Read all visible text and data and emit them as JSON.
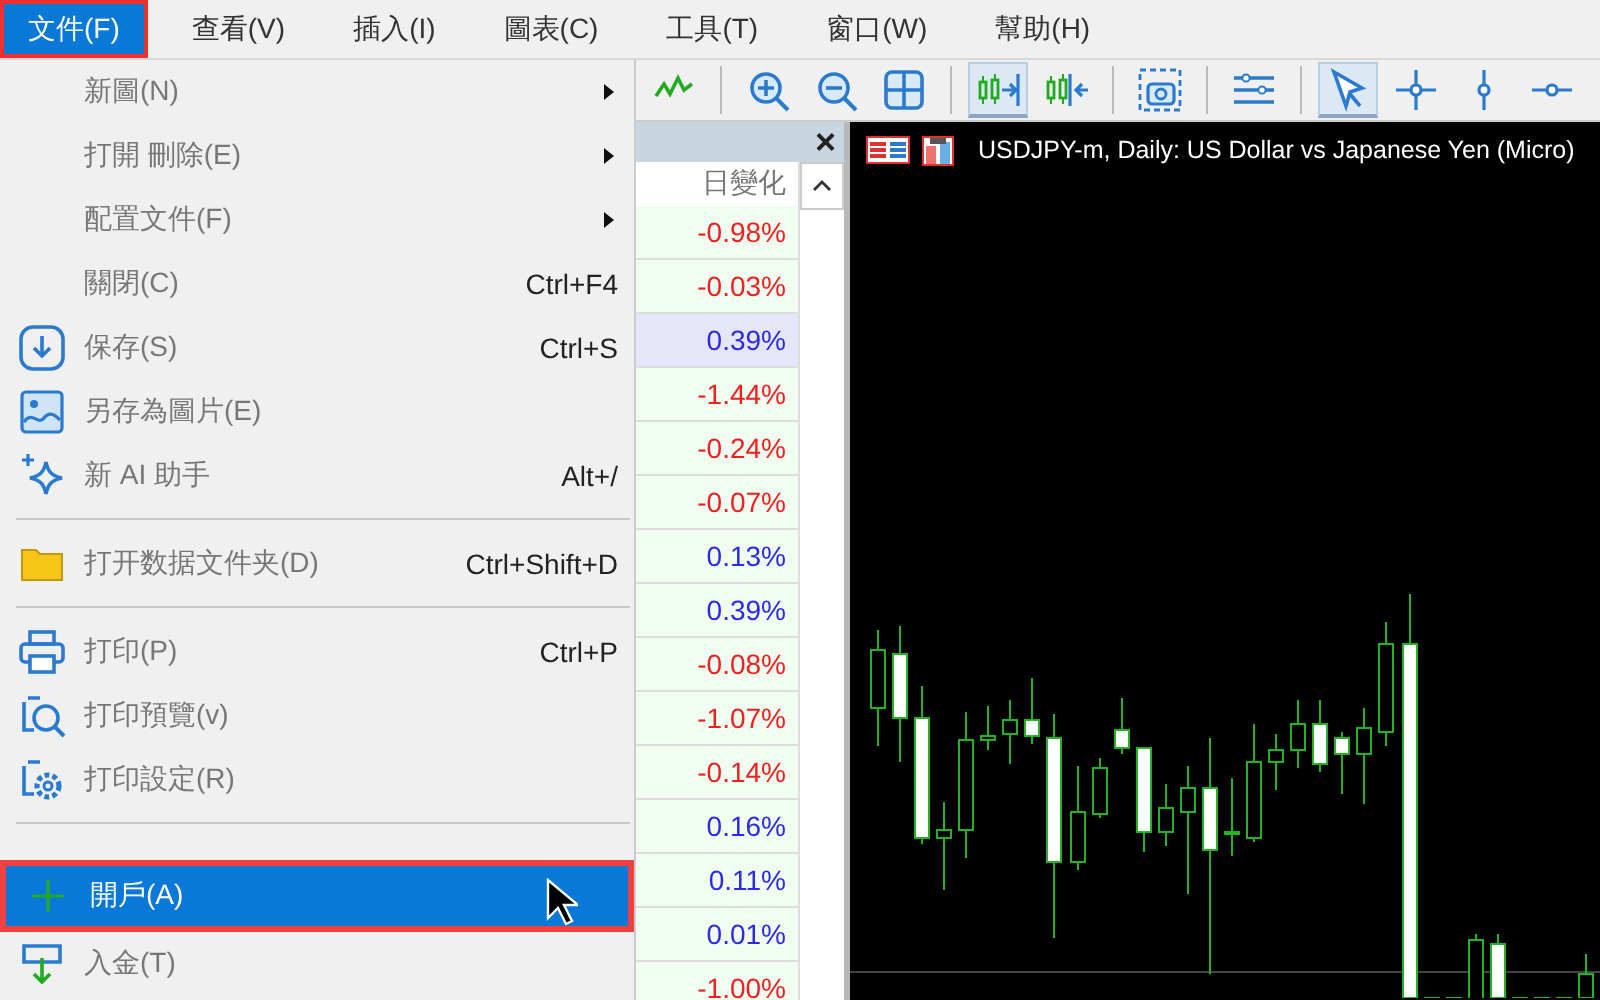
{
  "menu_bar": [
    {
      "label": "文件(F)",
      "selected": true
    },
    {
      "label": "查看(V)",
      "selected": false
    },
    {
      "label": "插入(I)",
      "selected": false
    },
    {
      "label": "圖表(C)",
      "selected": false
    },
    {
      "label": "工具(T)",
      "selected": false
    },
    {
      "label": "窗口(W)",
      "selected": false
    },
    {
      "label": "幫助(H)",
      "selected": false
    }
  ],
  "file_menu": [
    {
      "kind": "item",
      "label": "新圖(N)",
      "submenu": true,
      "selected": false
    },
    {
      "kind": "item",
      "label": "打開 刪除(E)",
      "submenu": true,
      "selected": false
    },
    {
      "kind": "item",
      "label": "配置文件(F)",
      "submenu": true,
      "selected": false
    },
    {
      "kind": "item",
      "label": "關閉(C)",
      "shortcut": "Ctrl+F4",
      "submenu": false,
      "selected": false
    },
    {
      "kind": "item",
      "label": "保存(S)",
      "shortcut": "Ctrl+S",
      "submenu": false,
      "selected": false
    },
    {
      "kind": "item",
      "label": "另存為圖片(E)",
      "submenu": false,
      "selected": false
    },
    {
      "kind": "item",
      "label": "新 AI 助手",
      "shortcut": "Alt+/",
      "submenu": false,
      "selected": false
    },
    {
      "kind": "separator"
    },
    {
      "kind": "item",
      "label": "打开数据文件夹(D)",
      "shortcut": "Ctrl+Shift+D",
      "submenu": false,
      "selected": false
    },
    {
      "kind": "separator"
    },
    {
      "kind": "item",
      "label": "打印(P)",
      "shortcut": "Ctrl+P",
      "submenu": false,
      "selected": false
    },
    {
      "kind": "item",
      "label": "打印預覽(v)",
      "submenu": false,
      "selected": false
    },
    {
      "kind": "item",
      "label": "打印設定(R)",
      "submenu": false,
      "selected": false
    },
    {
      "kind": "separator"
    },
    {
      "kind": "item",
      "label": "開戶(A)",
      "submenu": false,
      "selected": true
    },
    {
      "kind": "item",
      "label": "入金(T)",
      "submenu": false,
      "selected": false
    }
  ],
  "toolbar": [
    {
      "kind": "line-chart",
      "selected": false
    },
    {
      "kind": "zoom-in",
      "selected": false
    },
    {
      "kind": "zoom-out",
      "selected": false
    },
    {
      "kind": "grid",
      "selected": false
    },
    {
      "kind": "scroll-end",
      "selected": true
    },
    {
      "kind": "shift",
      "selected": false
    },
    {
      "kind": "screenshot",
      "selected": false
    },
    {
      "kind": "indicators",
      "selected": false
    },
    {
      "kind": "cursor",
      "selected": true
    },
    {
      "kind": "crosshair",
      "selected": false
    },
    {
      "kind": "vertical-line",
      "selected": false
    },
    {
      "kind": "horizontal-line",
      "selected": false
    }
  ],
  "market_watch": {
    "close": "×",
    "column": "日變化",
    "rows": [
      {
        "change": "-0.98%",
        "kind": "down",
        "selected": false
      },
      {
        "change": "-0.03%",
        "kind": "down",
        "selected": false
      },
      {
        "change": "0.39%",
        "kind": "up",
        "selected": true
      },
      {
        "change": "-1.44%",
        "kind": "down",
        "selected": false
      },
      {
        "change": "-0.24%",
        "kind": "down",
        "selected": false
      },
      {
        "change": "-0.07%",
        "kind": "down",
        "selected": false
      },
      {
        "change": "0.13%",
        "kind": "up",
        "selected": false
      },
      {
        "change": "0.39%",
        "kind": "up",
        "selected": false
      },
      {
        "change": "-0.08%",
        "kind": "down",
        "selected": false
      },
      {
        "change": "-1.07%",
        "kind": "down",
        "selected": false
      },
      {
        "change": "-0.14%",
        "kind": "down",
        "selected": false
      },
      {
        "change": "0.16%",
        "kind": "up",
        "selected": false
      },
      {
        "change": "0.11%",
        "kind": "up",
        "selected": false
      },
      {
        "change": "0.01%",
        "kind": "up",
        "selected": false
      },
      {
        "change": "-1.00%",
        "kind": "down",
        "selected": false
      }
    ]
  },
  "chart": {
    "title": "USDJPY-m, Daily:  US Dollar vs Japanese Yen (Micro)"
  }
}
